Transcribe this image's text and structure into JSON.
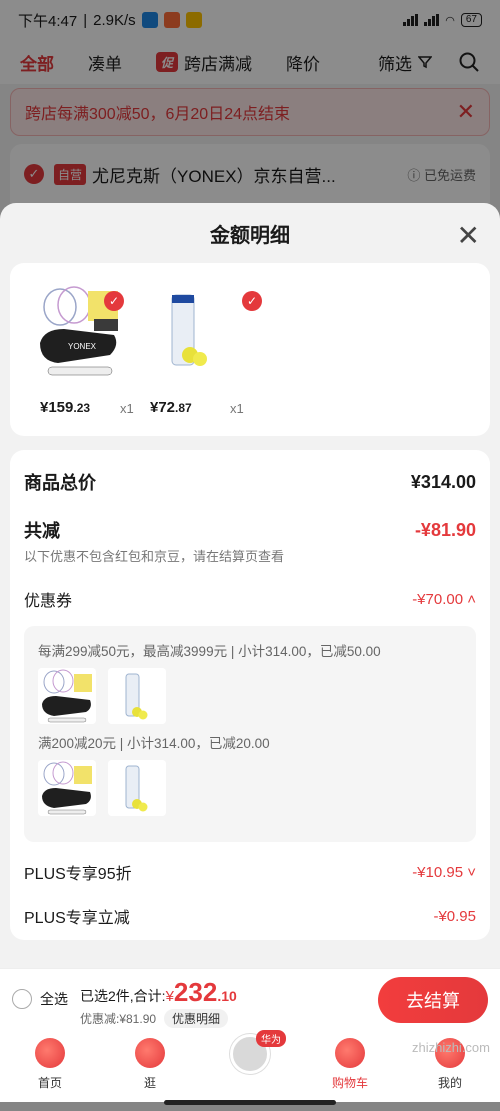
{
  "statusbar": {
    "time": "下午4:47",
    "speed": "2.9K/s",
    "battery": "67"
  },
  "tabs": {
    "all": "全部",
    "combine": "凑单",
    "promo_badge": "促",
    "cross_store": "跨店满减",
    "price_drop": "降价",
    "filter": "筛选"
  },
  "notice": {
    "text": "跨店每满300减50，6月20日24点结束",
    "close": "✕"
  },
  "store": {
    "badge": "自营",
    "name": "尤尼克斯（YONEX）京东自营...",
    "shipping": "ⓘ 已免运费"
  },
  "sheet": {
    "title": "金额明细",
    "close": "✕",
    "products": [
      {
        "price_int": "¥159",
        "price_dec": ".23",
        "qty": "x1"
      },
      {
        "price_int": "¥72",
        "price_dec": ".87",
        "qty": "x1"
      }
    ],
    "total_label": "商品总价",
    "total_value": "¥314.00",
    "reduce_label": "共减",
    "reduce_value": "-¥81.90",
    "note": "以下优惠不包含红包和京豆，请在结算页查看",
    "coupon_label": "优惠券",
    "coupon_value": "-¥70.00 ˄",
    "coupon_1": "每满299减50元，最高减3999元 | 小计314.00，已减50.00",
    "coupon_2": "满200减20元 | 小计314.00，已减20.00",
    "plus_discount_label": "PLUS专享95折",
    "plus_discount_value": "-¥10.95 ˅",
    "plus_cut_label": "PLUS专享立减",
    "plus_cut_value": "-¥0.95"
  },
  "checkout": {
    "select_all": "全选",
    "selected_prefix": "已选2件,合计:",
    "currency": "¥",
    "total_int": "232",
    "total_dec": ".10",
    "discount": "优惠减:¥81.90",
    "detail": "优惠明细",
    "pay": "去结算"
  },
  "nav": {
    "home": "首页",
    "browse": "逛",
    "huawei_badge": "华为",
    "cart": "购物车",
    "mine": "我的"
  },
  "watermark": "zhizhizhi.com",
  "colors": {
    "accent": "#e4393c"
  }
}
